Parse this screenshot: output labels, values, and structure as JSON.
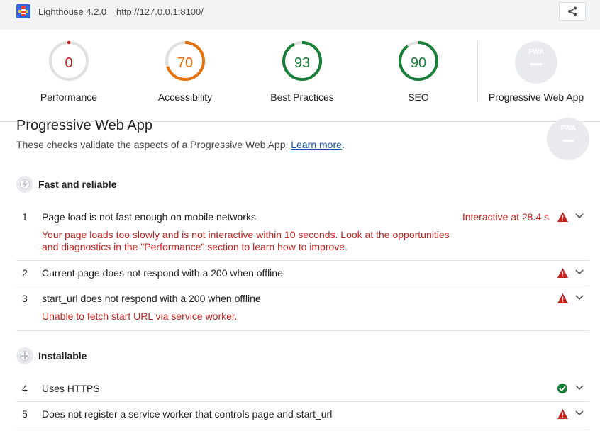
{
  "app": {
    "title": "Lighthouse 4.2.0",
    "url": "http://127.0.0.1:8100/"
  },
  "colors": {
    "fail": "#c5221f",
    "average": "#e8710a",
    "pass": "#188038",
    "gauge_track": "#e0e0e0",
    "pwa_badge": "#e8eaed"
  },
  "gauges": [
    {
      "value": "0",
      "label": "Performance",
      "score": 0,
      "color": "#c5221f"
    },
    {
      "value": "70",
      "label": "Accessibility",
      "score": 0.7,
      "color": "#e8710a"
    },
    {
      "value": "93",
      "label": "Best Practices",
      "score": 0.93,
      "color": "#188038"
    },
    {
      "value": "90",
      "label": "SEO",
      "score": 0.9,
      "color": "#188038"
    }
  ],
  "pwa": {
    "label": "Progressive Web App",
    "badge_text": "PWA"
  },
  "section": {
    "title": "Progressive Web App",
    "description": "These checks validate the aspects of a Progressive Web App.",
    "learn_more": "Learn more",
    "period": "."
  },
  "groups": [
    {
      "title": "Fast and reliable",
      "icon": "lightning-icon"
    },
    {
      "title": "Installable",
      "icon": "plus-icon"
    }
  ],
  "audits": [
    {
      "index": "1",
      "title": "Page load is not fast enough on mobile networks",
      "display_value": "Interactive at 28.4 s",
      "description": "Your page loads too slowly and is not interactive within 10 seconds. Look at the opportunities and diagnostics in the \"Performance\" section to learn how to improve.",
      "status": "fail"
    },
    {
      "index": "2",
      "title": "Current page does not respond with a 200 when offline",
      "display_value": "",
      "description": "",
      "status": "fail"
    },
    {
      "index": "3",
      "title": "start_url does not respond with a 200 when offline",
      "display_value": "",
      "description": "Unable to fetch start URL via service worker.",
      "status": "fail"
    },
    {
      "index": "4",
      "title": "Uses HTTPS",
      "display_value": "",
      "description": "",
      "status": "pass"
    },
    {
      "index": "5",
      "title": "Does not register a service worker that controls page and start_url",
      "display_value": "",
      "description": "",
      "status": "fail"
    }
  ]
}
